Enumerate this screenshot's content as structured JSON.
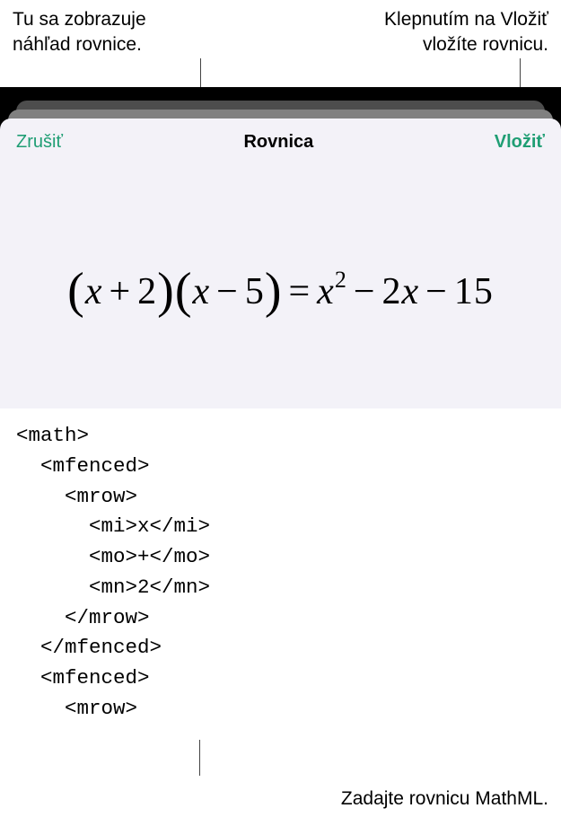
{
  "callouts": {
    "preview_l1": "Tu sa zobrazuje",
    "preview_l2": "náhľad rovnice.",
    "insert_l1": "Klepnutím na Vložiť",
    "insert_l2": "vložíte rovnicu.",
    "input": "Zadajte rovnicu MathML."
  },
  "header": {
    "cancel": "Zrušiť",
    "title": "Rovnica",
    "insert": "Vložiť"
  },
  "equation": {
    "display_html": "<span class=\"paren\">(</span>x<span class=\"op\">+</span><span class=\"num\">2</span><span class=\"paren\">)</span><span class=\"paren\">(</span>x<span class=\"op\">−</span><span class=\"num\">5</span><span class=\"paren\">)</span><span class=\"op\">=</span>x<sup>2</sup><span class=\"op\">−</span><span class=\"num\">2</span>x<span class=\"op\">−</span><span class=\"num\">15</span>"
  },
  "mathml": {
    "lines": [
      {
        "indent": 0,
        "text": "<math>"
      },
      {
        "indent": 1,
        "text": "<mfenced>"
      },
      {
        "indent": 2,
        "text": "<mrow>"
      },
      {
        "indent": 3,
        "text": "<mi>x</mi>"
      },
      {
        "indent": 3,
        "text": "<mo>+</mo>"
      },
      {
        "indent": 3,
        "text": "<mn>2</mn>"
      },
      {
        "indent": 2,
        "text": "</mrow>"
      },
      {
        "indent": 1,
        "text": "</mfenced>"
      },
      {
        "indent": 1,
        "text": "<mfenced>"
      },
      {
        "indent": 2,
        "text": "<mrow>"
      }
    ]
  }
}
